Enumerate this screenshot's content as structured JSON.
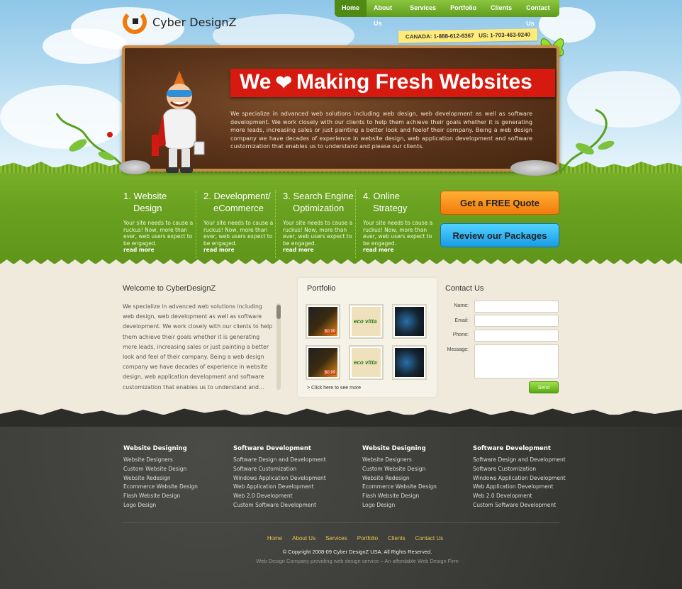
{
  "brand": {
    "name": "Cyber DesignZ"
  },
  "nav": {
    "items": [
      {
        "label": "Home",
        "active": true
      },
      {
        "label": "About Us"
      },
      {
        "label": "Services"
      },
      {
        "label": "Portfolio"
      },
      {
        "label": "Clients"
      },
      {
        "label": "Contact Us"
      }
    ]
  },
  "phone": {
    "text": "CANADA: 1-888-612-6367   US: 1-703-463-9240"
  },
  "hero": {
    "headline_left": "We",
    "headline_right": "Making Fresh Websites",
    "heart_icon": "heart-icon",
    "copy": "We specialize in advanced web solutions including web design, web development as well as software development. We work closely with our clients to help them achieve their goals whether it is generating more leads, increasing sales or just painting a better look and feelof their company. Being a web design company we have decades of experience in website design, web application development and software customization that enables us to understand and please our clients."
  },
  "services": [
    {
      "line1": "1. Website",
      "line2": "Design",
      "desc": "Your site needs to cause a ruckus! Now, more than ever, web users expect to be engaged.",
      "more": "read more"
    },
    {
      "line1": "2. Development/",
      "line2": "eCommerce",
      "desc": "Your site needs to cause a ruckus! Now, more than ever, web users expect to be engaged.",
      "more": "read more"
    },
    {
      "line1": "3. Search Engine",
      "line2": "Optimization",
      "desc": "Your site needs to cause a ruckus! Now, more than ever, web users expect to be engaged.",
      "more": "read more"
    },
    {
      "line1": "4. Online",
      "line2": "Strategy",
      "desc": "Your site needs to cause a ruckus! Now, more than ever, web users expect to be engaged.",
      "more": "read more"
    }
  ],
  "cta": {
    "quote": "Get a FREE Quote",
    "packages": "Review our Packages"
  },
  "welcome": {
    "title": "Welcome to CyberDesignZ",
    "text": "We specialize in advanced web solutions including web design, web development as well as software development. We work closely with our clients to help them achieve their goals whether it is generating more leads, increasing sales or just painting a better look and feel of their company. Being a web design company we have decades of experience in website design, web application development and software customization that enables us to understand and..."
  },
  "portfolio": {
    "title": "Portfolio",
    "thumbs": [
      {
        "kind": "phone",
        "price": "$0.99"
      },
      {
        "kind": "eco",
        "label": "eco vitta"
      },
      {
        "kind": "dark"
      },
      {
        "kind": "phone",
        "price": "$0.99"
      },
      {
        "kind": "eco",
        "label": "eco vitta"
      },
      {
        "kind": "dark"
      }
    ],
    "link": "> Click here to see more"
  },
  "contact": {
    "title": "Contact Us",
    "name_label": "Name:",
    "email_label": "Email:",
    "phone_label": "Phone:",
    "message_label": "Message:",
    "send": "Send"
  },
  "footer": {
    "columns": [
      {
        "head": "Website Designing",
        "links": [
          "Website Designers",
          "Custom Website Design",
          "Website Redesign",
          "Ecommerce Website Design",
          "Flash Website Design",
          "Logo Design"
        ]
      },
      {
        "head": "Software Development",
        "links": [
          "Software Design and Development",
          "Software Customization",
          "Windows Application Development",
          "Web Application Development",
          "Web 2.0 Development",
          "Custom Software Development"
        ]
      },
      {
        "head": "Website Designing",
        "links": [
          "Website Designers",
          "Custom Website Design",
          "Website Redesign",
          "Ecommerce Website Design",
          "Flash Website Design",
          "Logo Design"
        ]
      },
      {
        "head": "Software Development",
        "links": [
          "Software Design and Development",
          "Software Customization",
          "Windows Application Development",
          "Web Application Development",
          "Web 2.0 Development",
          "Custom Software Development"
        ]
      }
    ],
    "nav": [
      "Home",
      "About Us",
      "Services",
      "Portfolio",
      "Clients",
      "Contact Us"
    ],
    "copyright": "© Copyright 2008-09 Cyber DesignZ USA. All Rights Reserved.",
    "tagline": "Web Design Company providing web design service – An affordable Web Design Firm"
  },
  "colors": {
    "accent_green": "#6aa120",
    "banner_red": "#d71a10",
    "cta_orange": "#f27a0c",
    "cta_blue": "#1a9be6",
    "footer_link_gold": "#e9c84a"
  }
}
